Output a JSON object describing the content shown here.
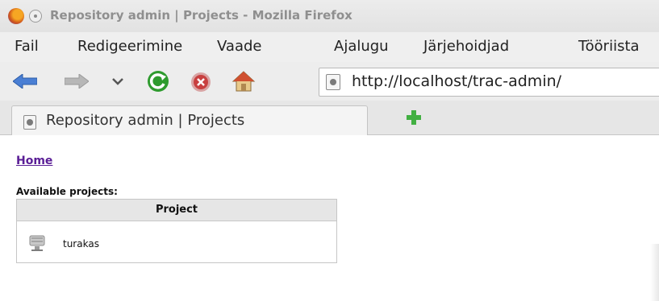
{
  "window": {
    "title": "Repository admin | Projects - Mozilla Firefox"
  },
  "menu": {
    "items": [
      "Fail",
      "Redigeerimine",
      "Vaade",
      "Ajalugu",
      "Järjehoidjad",
      "Tööriista"
    ]
  },
  "navigation": {
    "url": "http://localhost/trac-admin/",
    "icons": [
      "back-arrow-icon",
      "forward-arrow-icon",
      "history-dropdown-icon",
      "reload-icon",
      "stop-icon",
      "home-icon",
      "site-identity-icon"
    ]
  },
  "tabs": {
    "active_label": "Repository admin | Projects"
  },
  "page": {
    "home_link": "Home",
    "available_label": "Available projects:",
    "table": {
      "header": "Project",
      "rows": [
        {
          "name": "turakas"
        }
      ]
    }
  },
  "colors": {
    "link_visited": "#5a1e96",
    "nav_arrow": "#4a7fd4",
    "reload": "#2e9b2e",
    "stop": "#c84040",
    "new_tab": "#42b042"
  }
}
